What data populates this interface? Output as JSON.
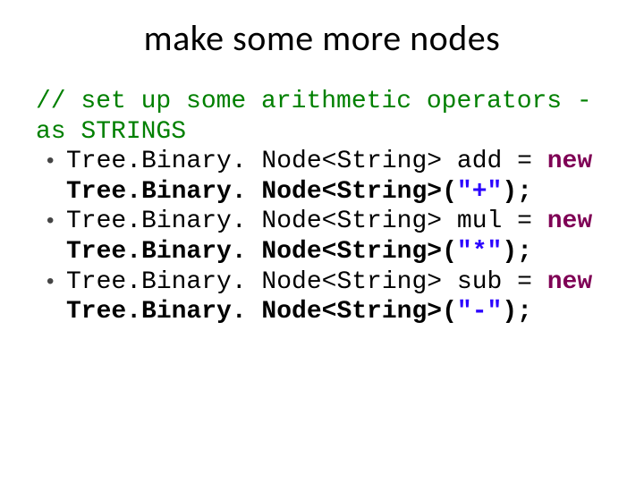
{
  "title": "make some more nodes",
  "comment": "// set up some arithmetic operators - as STRINGS",
  "items": [
    {
      "decl_type": "Tree.Binary. Node<String>",
      "var": "add",
      "eq": " = ",
      "kw_new": "new",
      "ctor": "Tree.Binary. Node<String>",
      "open": "(",
      "literal": "\"+\"",
      "close": ");"
    },
    {
      "decl_type": "Tree.Binary. Node<String>",
      "var": "mul",
      "eq": " = ",
      "kw_new": "new",
      "ctor": "Tree.Binary. Node<String>",
      "open": "(",
      "literal": "\"*\"",
      "close": ");"
    },
    {
      "decl_type": "Tree.Binary. Node<String>",
      "var": "sub",
      "eq": " = ",
      "kw_new": "new",
      "ctor": "Tree.Binary. Node<String>",
      "open": "(",
      "literal": "\"-\"",
      "close": ");"
    }
  ]
}
